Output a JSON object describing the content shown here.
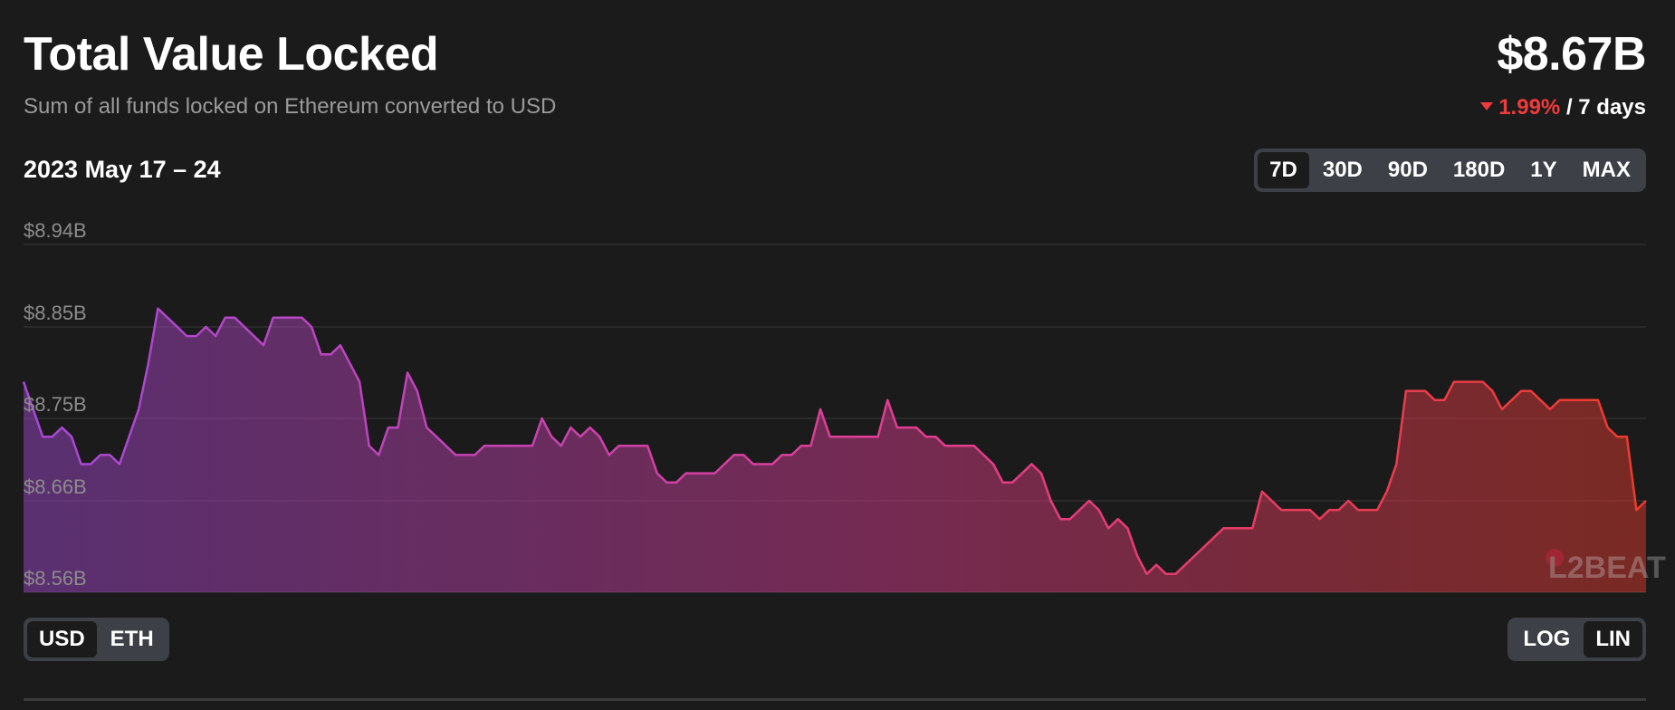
{
  "header": {
    "title": "Total Value Locked",
    "subtitle": "Sum of all funds locked on Ethereum converted to USD",
    "total_value": "$8.67B",
    "change": "1.99%",
    "period": "/ 7 days"
  },
  "range_label": "2023 May 17 – 24",
  "range_options": [
    {
      "label": "7D",
      "active": true
    },
    {
      "label": "30D",
      "active": false
    },
    {
      "label": "90D",
      "active": false
    },
    {
      "label": "180D",
      "active": false
    },
    {
      "label": "1Y",
      "active": false
    },
    {
      "label": "MAX",
      "active": false
    }
  ],
  "unit_options": [
    {
      "label": "USD",
      "active": true
    },
    {
      "label": "ETH",
      "active": false
    }
  ],
  "scale_options": [
    {
      "label": "LOG",
      "active": false
    },
    {
      "label": "LIN",
      "active": true
    }
  ],
  "watermark": "L2BEAT",
  "colors": {
    "background": "#1b1b1b",
    "line_start": "#a649d9",
    "line_mid": "#e33d92",
    "line_end": "#ef3b2c",
    "negative_change": "#ef3b3b"
  },
  "icons": {
    "change_indicator": "triangle-down-icon"
  },
  "chart_data": {
    "type": "area",
    "title": "",
    "xlabel": "",
    "ylabel": "",
    "ylim": [
      8.56,
      8.94
    ],
    "y_ticks": [
      "$8.94B",
      "$8.85B",
      "$8.75B",
      "$8.66B",
      "$8.56B"
    ],
    "y_tick_values": [
      8.94,
      8.85,
      8.75,
      8.66,
      8.56
    ],
    "grid": true,
    "x_range": [
      "2023-05-17",
      "2023-05-24"
    ],
    "series": [
      {
        "values": [
          8.79,
          8.76,
          8.73,
          8.73,
          8.74,
          8.73,
          8.7,
          8.7,
          8.71,
          8.71,
          8.7,
          8.73,
          8.76,
          8.81,
          8.87,
          8.86,
          8.85,
          8.84,
          8.84,
          8.85,
          8.84,
          8.86,
          8.86,
          8.85,
          8.84,
          8.83,
          8.86,
          8.86,
          8.86,
          8.86,
          8.85,
          8.82,
          8.82,
          8.83,
          8.81,
          8.79,
          8.72,
          8.71,
          8.74,
          8.74,
          8.8,
          8.78,
          8.74,
          8.73,
          8.72,
          8.71,
          8.71,
          8.71,
          8.72,
          8.72,
          8.72,
          8.72,
          8.72,
          8.72,
          8.75,
          8.73,
          8.72,
          8.74,
          8.73,
          8.74,
          8.73,
          8.71,
          8.72,
          8.72,
          8.72,
          8.72,
          8.69,
          8.68,
          8.68,
          8.69,
          8.69,
          8.69,
          8.69,
          8.7,
          8.71,
          8.71,
          8.7,
          8.7,
          8.7,
          8.71,
          8.71,
          8.72,
          8.72,
          8.76,
          8.73,
          8.73,
          8.73,
          8.73,
          8.73,
          8.73,
          8.77,
          8.74,
          8.74,
          8.74,
          8.73,
          8.73,
          8.72,
          8.72,
          8.72,
          8.72,
          8.71,
          8.7,
          8.68,
          8.68,
          8.69,
          8.7,
          8.69,
          8.66,
          8.64,
          8.64,
          8.65,
          8.66,
          8.65,
          8.63,
          8.64,
          8.63,
          8.6,
          8.58,
          8.59,
          8.58,
          8.58,
          8.59,
          8.6,
          8.61,
          8.62,
          8.63,
          8.63,
          8.63,
          8.63,
          8.67,
          8.66,
          8.65,
          8.65,
          8.65,
          8.65,
          8.64,
          8.65,
          8.65,
          8.66,
          8.65,
          8.65,
          8.65,
          8.67,
          8.7,
          8.78,
          8.78,
          8.78,
          8.77,
          8.77,
          8.79,
          8.79,
          8.79,
          8.79,
          8.78,
          8.76,
          8.77,
          8.78,
          8.78,
          8.77,
          8.76,
          8.77,
          8.77,
          8.77,
          8.77,
          8.77,
          8.74,
          8.73,
          8.73,
          8.65,
          8.66
        ]
      }
    ]
  }
}
